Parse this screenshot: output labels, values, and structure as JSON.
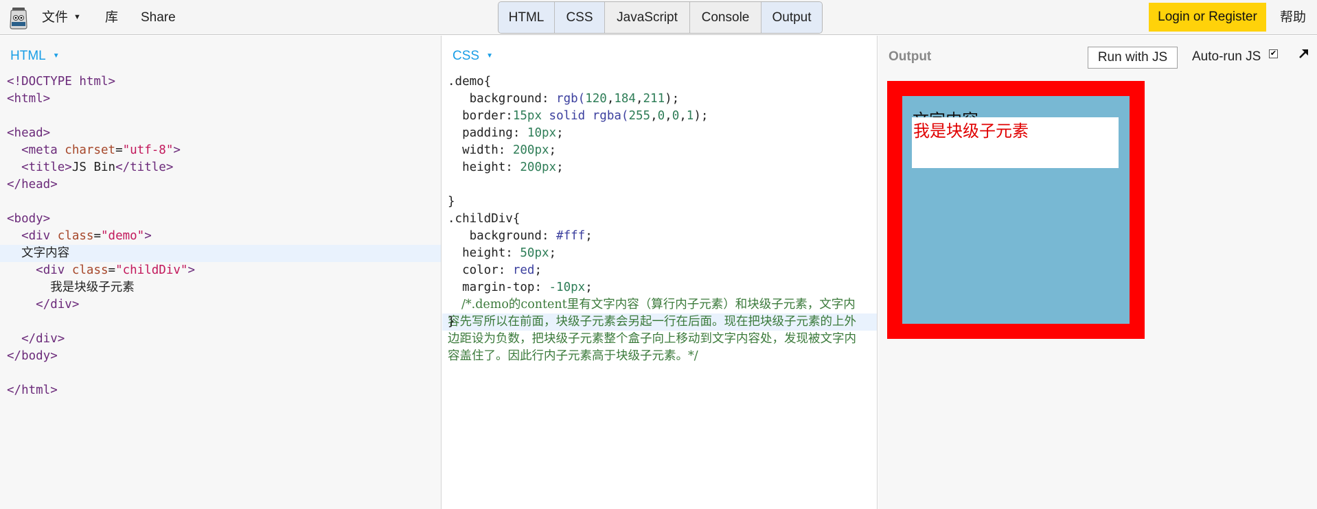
{
  "topbar": {
    "menu_file": "文件",
    "menu_library": "库",
    "menu_share": "Share",
    "tabs": [
      "HTML",
      "CSS",
      "JavaScript",
      "Console",
      "Output"
    ],
    "login": "Login or Register",
    "help": "帮助"
  },
  "html_panel": {
    "label": "HTML",
    "lines": {
      "l1": "<!DOCTYPE html>",
      "l2": "<html>",
      "l4": "<head>",
      "l5a": "<meta ",
      "l5b": "charset",
      "l5c": "=",
      "l5d": "\"utf-8\"",
      "l5e": ">",
      "l6a": "<title>",
      "l6b": "JS Bin",
      "l6c": "</title>",
      "l7": "</head>",
      "l9": "<body>",
      "l10a": "<div ",
      "l10b": "class",
      "l10c": "=",
      "l10d": "\"demo\"",
      "l10e": ">",
      "l11": "文字内容",
      "l12a": "<div ",
      "l12b": "class",
      "l12c": "=",
      "l12d": "\"childDiv\"",
      "l12e": ">",
      "l13": "我是块级子元素",
      "l14": "</div>",
      "l16": "</div>",
      "l17": "</body>",
      "l19": "</html>"
    }
  },
  "css_panel": {
    "label": "CSS",
    "lines": {
      "c1": ".demo{",
      "c2a": "background",
      "c2b": ": ",
      "c2c": "rgb(",
      "c2d": "120",
      "c2e": ",",
      "c2f": "184",
      "c2g": ",",
      "c2h": "211",
      "c2i": ");",
      "c3a": "border",
      "c3b": ":",
      "c3c": "15px",
      "c3d": " solid ",
      "c3e": "rgba(",
      "c3f": "255",
      "c3g": ",",
      "c3h": "0",
      "c3i": ",",
      "c3j": "0",
      "c3k": ",",
      "c3l": "1",
      "c3m": ");",
      "c4a": "padding",
      "c4b": ": ",
      "c4c": "10px",
      "c4d": ";",
      "c5a": "width",
      "c5b": ": ",
      "c5c": "200px",
      "c5d": ";",
      "c6a": "height",
      "c6b": ": ",
      "c6c": "200px",
      "c6d": ";",
      "c8": "}",
      "c9": ".childDiv{",
      "c10a": "background",
      "c10b": ": ",
      "c10c": "#fff",
      "c10d": ";",
      "c11a": "height",
      "c11b": ": ",
      "c11c": "50px",
      "c11d": ";",
      "c12a": "color",
      "c12b": ": ",
      "c12c": "red",
      "c12d": ";",
      "c13a": "margin-top",
      "c13b": ": ",
      "c13c": "-10px",
      "c13d": ";",
      "comment": "/*.demo的content里有文字内容（算行内子元素）和块级子元素，文字内容先写所以在前面，块级子元素会另起一行在后面。现在把块级子元素的上外边距设为负数，把块级子元素整个盒子向上移动到文字内容处，发现被文字内容盖住了。因此行内子元素高于块级子元素。*/",
      "c20": "}"
    }
  },
  "output_panel": {
    "label": "Output",
    "run_button": "Run with JS",
    "autorun_label": "Auto-run JS",
    "autorun_checked": true,
    "demo_text": "文字内容",
    "child_text": "我是块级子元素",
    "demo_background": "#78b8d3",
    "demo_border": "#ff0000",
    "child_color": "#e00000"
  }
}
